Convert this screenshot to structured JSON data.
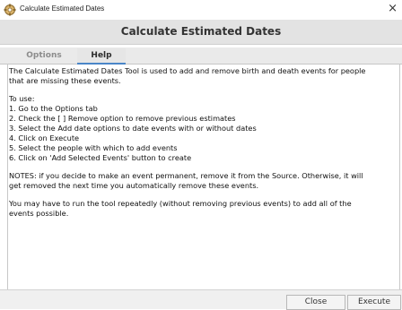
{
  "window": {
    "title": "Calculate Estimated Dates",
    "close_glyph": "×",
    "icon": "gramps-tool-icon"
  },
  "dialog": {
    "title": "Calculate Estimated Dates"
  },
  "tabs": [
    {
      "label": "Options",
      "selected": false
    },
    {
      "label": "Help",
      "selected": true
    }
  ],
  "help": {
    "intro_1": "The Calculate Estimated Dates Tool is used to add and remove birth and death events for people",
    "intro_2": "that are missing these events.",
    "to_use": "To use:",
    "steps": [
      "1. Go to the Options tab",
      "2. Check the [ ] Remove option to remove previous estimates",
      "3. Select the Add date options to date events with or without dates",
      "4. Click on Execute",
      "5. Select the people with which to add events",
      "6. Click on 'Add Selected Events' button to create"
    ],
    "notes_1": "NOTES: if you decide to make an event permanent, remove it from the Source. Otherwise, it will",
    "notes_2": "get removed the next time you automatically remove these events.",
    "repeat_1": "You may have to run the tool repeatedly (without removing previous events) to add all of the",
    "repeat_2": "events possible."
  },
  "buttons": {
    "close": "Close",
    "execute": "Execute"
  },
  "colors": {
    "tab_selected_underline": "#4a86c8",
    "header_band": "#e3e3e3"
  }
}
